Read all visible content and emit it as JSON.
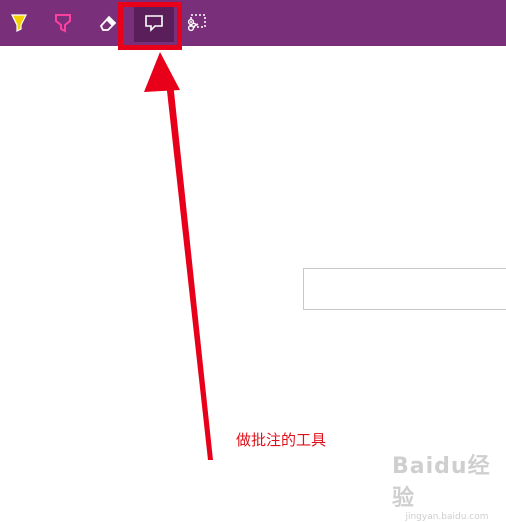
{
  "toolbar": {
    "background": "#7a2f7a",
    "tools": [
      {
        "name": "yellow-highlighter",
        "icon": "highlighter-icon",
        "color": "#f5d000"
      },
      {
        "name": "pink-highlighter",
        "icon": "highlighter-icon",
        "color": "#ff3fa0"
      },
      {
        "name": "eraser",
        "icon": "eraser-icon",
        "color": "#ffffff"
      },
      {
        "name": "comment",
        "icon": "comment-icon",
        "color": "#ffffff",
        "selected": true
      },
      {
        "name": "clip",
        "icon": "clip-icon",
        "color": "#ffffff"
      }
    ]
  },
  "annotation": {
    "text": "做批注的工具",
    "color": "#e0101a"
  },
  "watermark": {
    "brand": "Baidu经验",
    "sub": "jingyan.baidu.com"
  }
}
